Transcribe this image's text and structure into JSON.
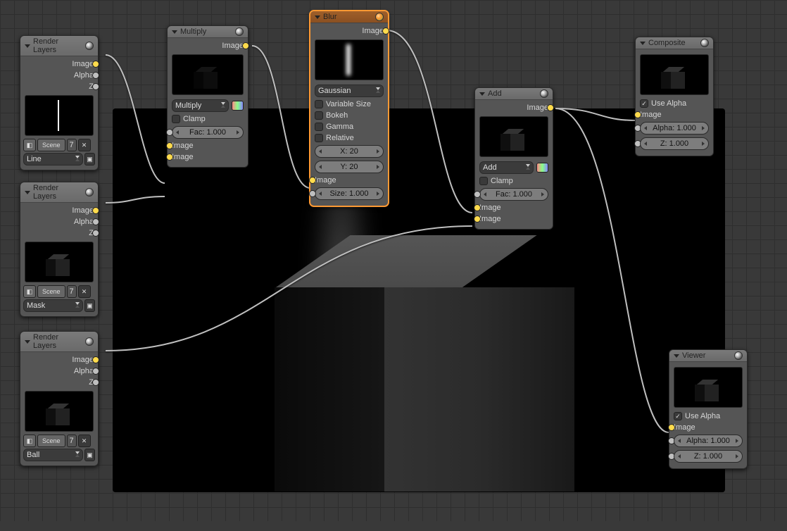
{
  "nodes": {
    "rl_line": {
      "title": "Render Layers",
      "scene": "Scene",
      "layer_num": "7",
      "layer": "Line",
      "out": [
        "Image",
        "Alpha",
        "Z"
      ]
    },
    "rl_mask": {
      "title": "Render Layers",
      "scene": "Scene",
      "layer_num": "7",
      "layer": "Mask",
      "out": [
        "Image",
        "Alpha",
        "Z"
      ]
    },
    "rl_ball": {
      "title": "Render Layers",
      "scene": "Scene",
      "layer_num": "7",
      "layer": "Ball",
      "out": [
        "Image",
        "Alpha",
        "Z"
      ]
    },
    "multiply": {
      "title": "Multiply",
      "blend": "Multiply",
      "clamp": "Clamp",
      "fac": "Fac: 1.000",
      "out": "Image",
      "in": [
        "Image",
        "Image"
      ]
    },
    "blur": {
      "title": "Blur",
      "out": "Image",
      "type": "Gaussian",
      "variable": "Variable Size",
      "bokeh": "Bokeh",
      "gamma": "Gamma",
      "relative": "Relative",
      "x": "X: 20",
      "y": "Y: 20",
      "size": "Size: 1.000",
      "in": "Image"
    },
    "add": {
      "title": "Add",
      "out": "Image",
      "blend": "Add",
      "clamp": "Clamp",
      "fac": "Fac: 1.000",
      "in": [
        "Image",
        "Image"
      ]
    },
    "composite": {
      "title": "Composite",
      "usealpha": "Use Alpha",
      "in_img": "Image",
      "in_a": "Alpha: 1.000",
      "in_z": "Z: 1.000"
    },
    "viewer": {
      "title": "Viewer",
      "usealpha": "Use Alpha",
      "in_img": "Image",
      "in_a": "Alpha: 1.000",
      "in_z": "Z: 1.000"
    }
  }
}
